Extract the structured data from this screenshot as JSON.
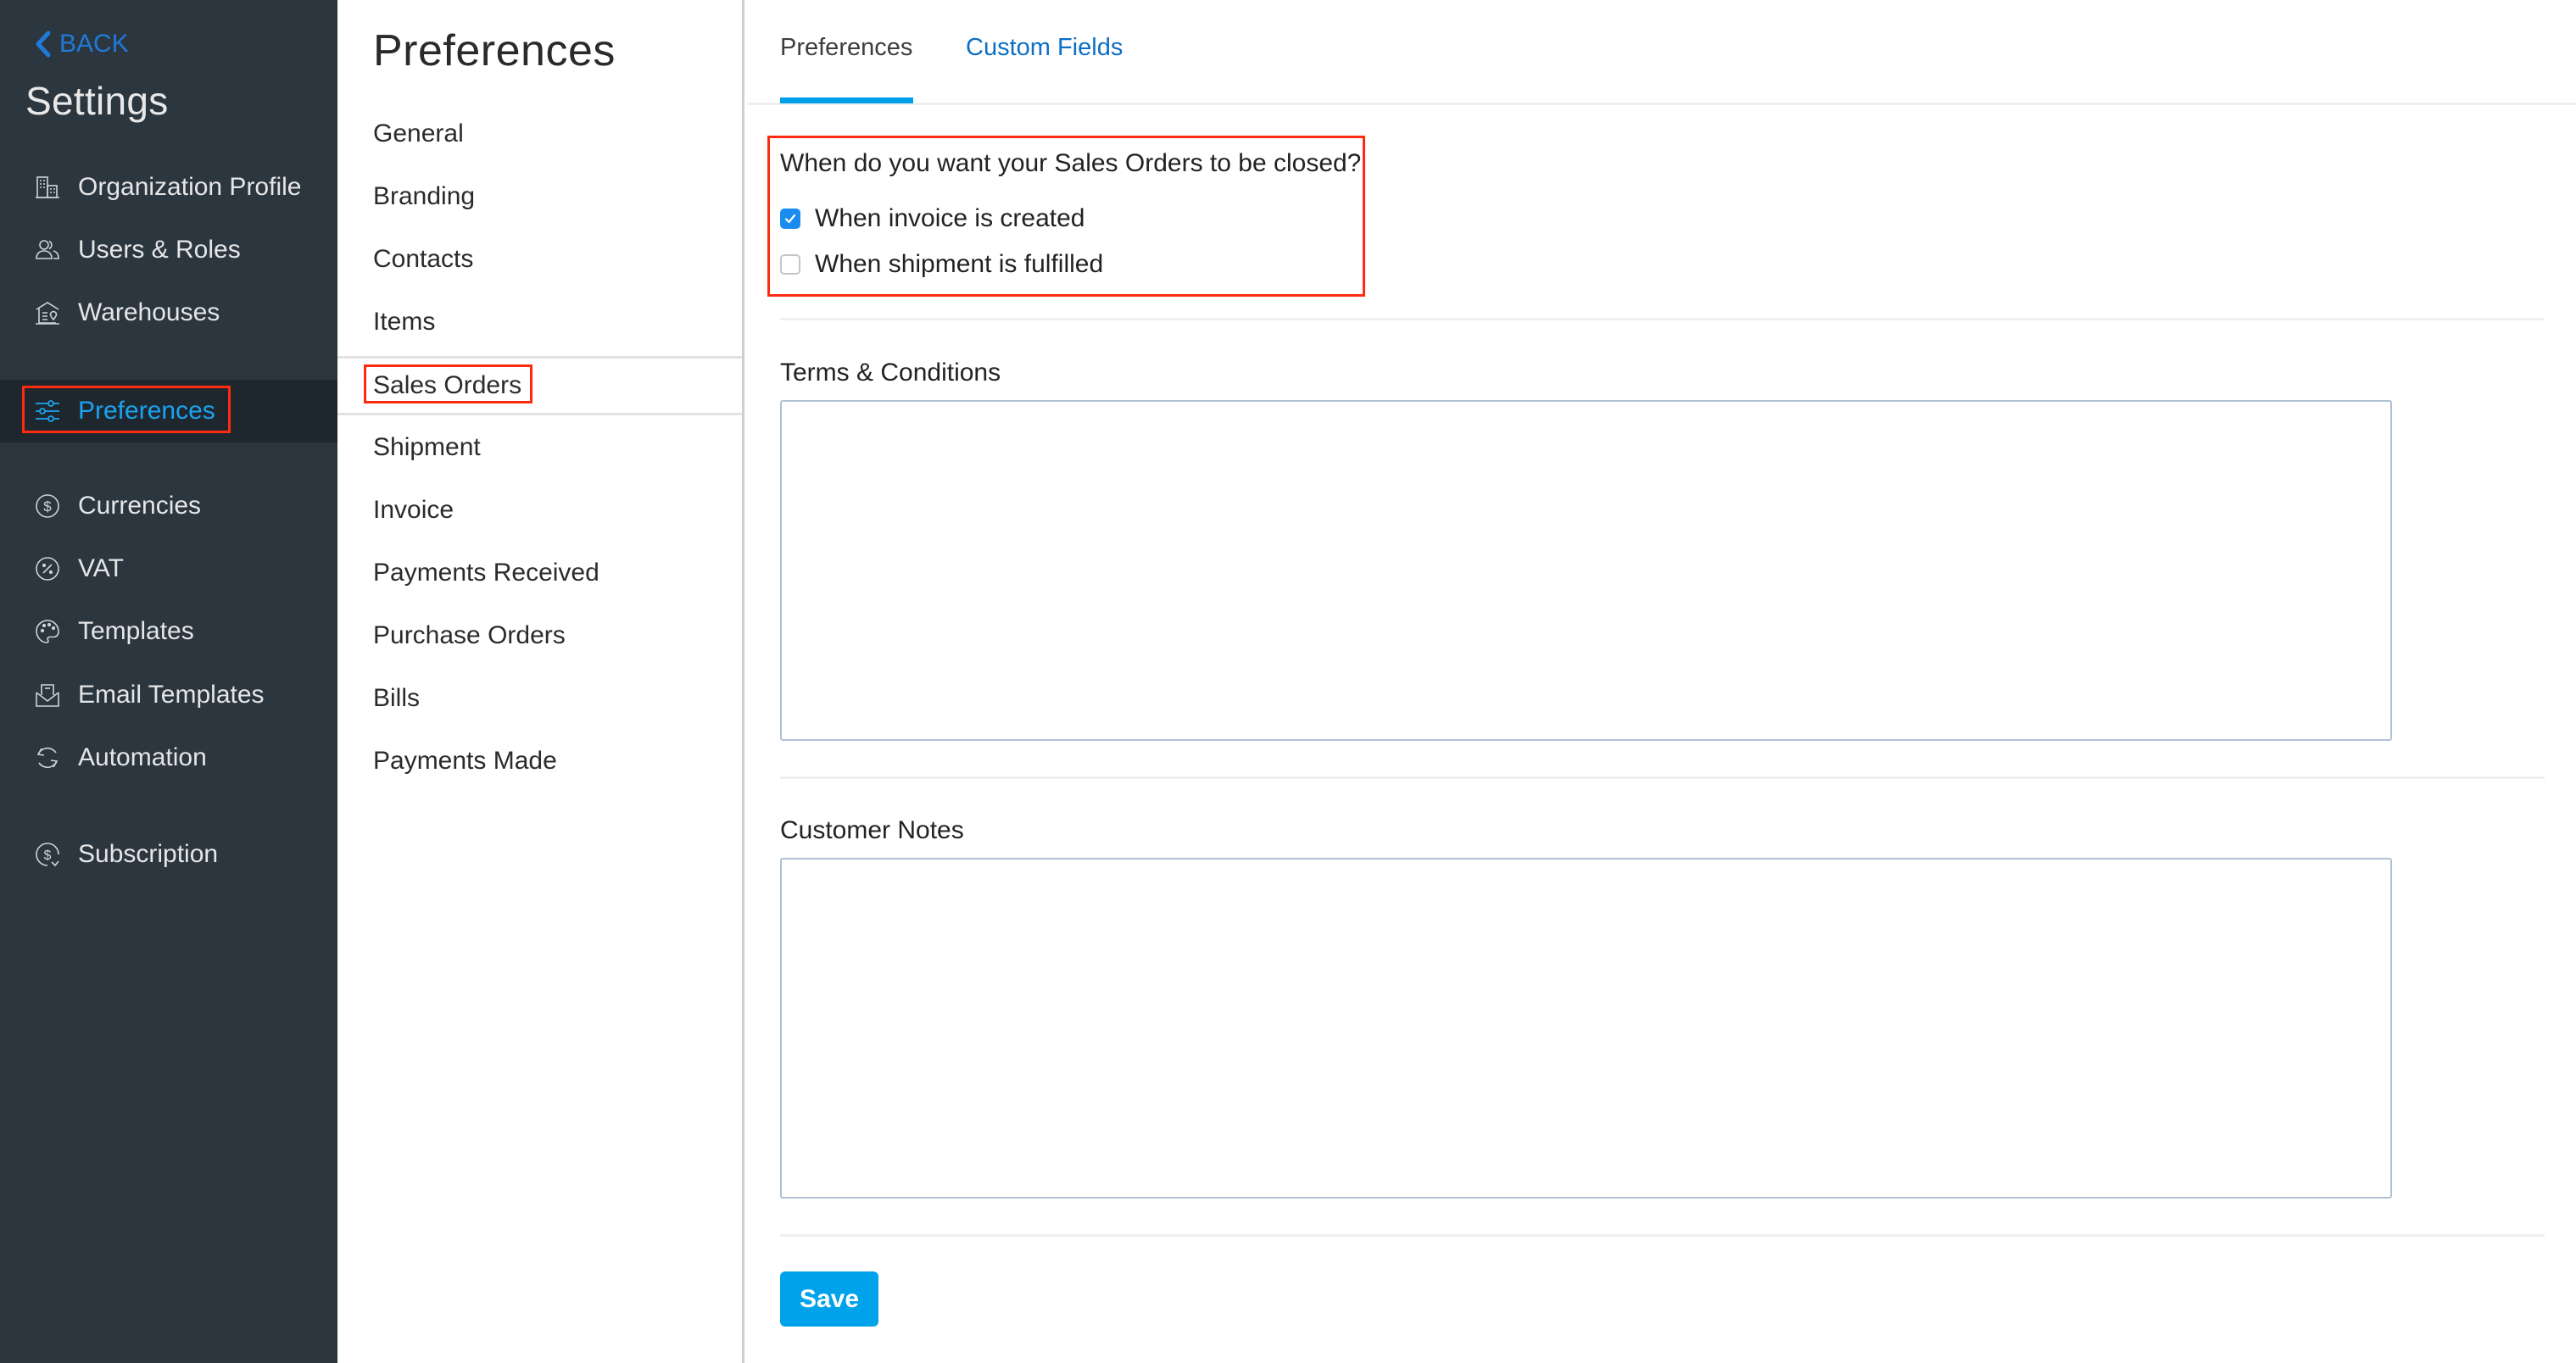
{
  "sidebar": {
    "back_label": "BACK",
    "title": "Settings",
    "items": [
      {
        "label": "Organization Profile",
        "icon": "building-icon",
        "active": false
      },
      {
        "label": "Users & Roles",
        "icon": "users-icon",
        "active": false
      },
      {
        "label": "Warehouses",
        "icon": "warehouse-icon",
        "active": false
      },
      {
        "label": "Preferences",
        "icon": "sliders-icon",
        "active": true
      },
      {
        "label": "Currencies",
        "icon": "dollar-circle-icon",
        "active": false
      },
      {
        "label": "VAT",
        "icon": "percent-circle-icon",
        "active": false
      },
      {
        "label": "Templates",
        "icon": "palette-icon",
        "active": false
      },
      {
        "label": "Email Templates",
        "icon": "envelope-open-icon",
        "active": false
      },
      {
        "label": "Automation",
        "icon": "refresh-icon",
        "active": false
      },
      {
        "label": "Subscription",
        "icon": "subscription-icon",
        "active": false
      }
    ]
  },
  "subpanel": {
    "title": "Preferences",
    "items": [
      {
        "label": "General"
      },
      {
        "label": "Branding"
      },
      {
        "label": "Contacts"
      },
      {
        "label": "Items"
      },
      {
        "label": "Sales Orders",
        "active": true
      },
      {
        "label": "Shipment"
      },
      {
        "label": "Invoice"
      },
      {
        "label": "Payments Received"
      },
      {
        "label": "Purchase Orders"
      },
      {
        "label": "Bills"
      },
      {
        "label": "Payments Made"
      }
    ]
  },
  "main": {
    "tabs": [
      {
        "label": "Preferences",
        "active": true
      },
      {
        "label": "Custom Fields",
        "active": false
      }
    ],
    "close_question": "When do you want your Sales Orders to be closed?",
    "options": [
      {
        "label": "When invoice is created",
        "checked": true
      },
      {
        "label": "When shipment is fulfilled",
        "checked": false
      }
    ],
    "terms_label": "Terms & Conditions",
    "terms_value": "",
    "notes_label": "Customer Notes",
    "notes_value": "",
    "save_label": "Save"
  },
  "colors": {
    "accent": "#00a0e8",
    "link": "#0b6fc6",
    "sidebar_bg": "#2c363e",
    "highlight": "#ff2a10"
  }
}
